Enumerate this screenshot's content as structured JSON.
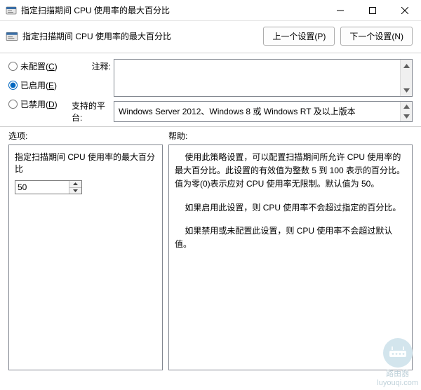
{
  "window": {
    "title": "指定扫描期间 CPU 使用率的最大百分比"
  },
  "header": {
    "policy_name": "指定扫描期间 CPU 使用率的最大百分比",
    "prev_button": "上一个设置(P)",
    "next_button": "下一个设置(N)"
  },
  "radios": {
    "not_configured": {
      "label": "未配置(",
      "accel": "C",
      "suffix": ")",
      "checked": false
    },
    "enabled": {
      "label": "已启用(",
      "accel": "E",
      "suffix": ")",
      "checked": true
    },
    "disabled": {
      "label": "已禁用(",
      "accel": "D",
      "suffix": ")",
      "checked": false
    }
  },
  "labels": {
    "comment": "注释:",
    "supported": "支持的平台:",
    "options": "选项:",
    "help": "帮助:"
  },
  "platform_text": "Windows Server 2012、Windows 8 或 Windows RT 及以上版本",
  "options_panel": {
    "field_label": "指定扫描期间 CPU 使用率的最大百分比",
    "value": "50"
  },
  "help_text": {
    "p1": "使用此策略设置，可以配置扫描期间所允许 CPU 使用率的最大百分比。此设置的有效值为整数 5 到 100 表示的百分比。值为零(0)表示应对 CPU 使用率无限制。默认值为 50。",
    "p2": "如果启用此设置，则 CPU 使用率不会超过指定的百分比。",
    "p3": "如果禁用或未配置此设置，则 CPU 使用率不会超过默认值。"
  },
  "watermark": {
    "text": "路由器",
    "domain": "luyouqi.com"
  }
}
